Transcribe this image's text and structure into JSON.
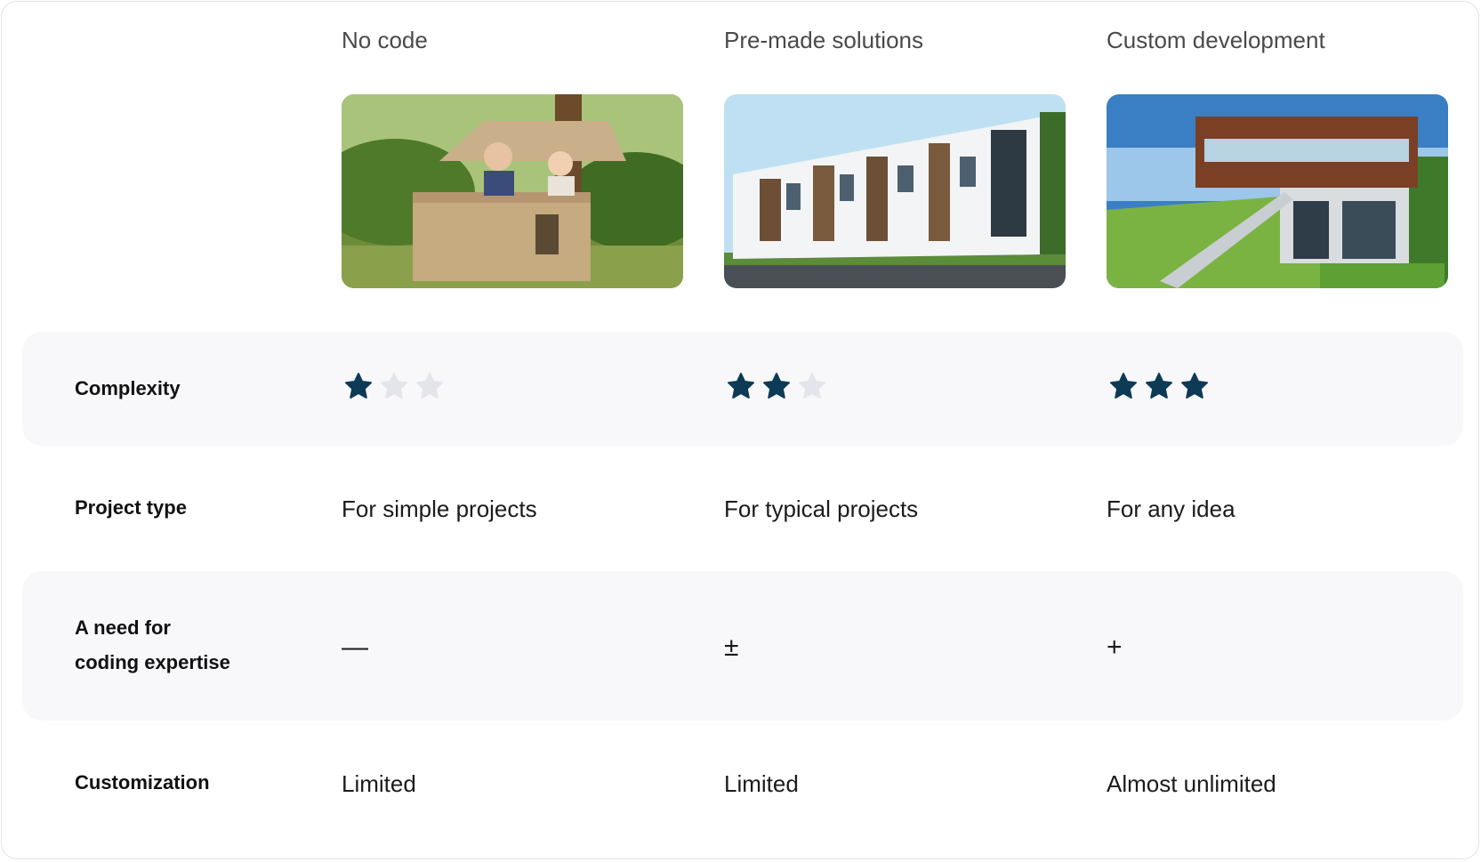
{
  "columns": [
    {
      "title": "No code",
      "image": "cardboard-playhouse-photo",
      "stars": 1,
      "project_type": "For simple projects",
      "coding_symbol": "—",
      "customization": "Limited"
    },
    {
      "title": "Pre-made solutions",
      "image": "townhouses-photo",
      "stars": 2,
      "project_type": "For typical projects",
      "coding_symbol": "±",
      "customization": "Limited"
    },
    {
      "title": "Custom development",
      "image": "modern-building-photo",
      "stars": 3,
      "project_type": "For any idea",
      "coding_symbol": "+",
      "customization": "Almost unlimited"
    }
  ],
  "rows": {
    "complexity": "Complexity",
    "project_type": "Project type",
    "coding_line1": "A need for",
    "coding_line2": "coding expertise",
    "customization": "Customization"
  },
  "colors": {
    "star_filled": "#0d3a55",
    "star_empty": "#e4e5ea",
    "band": "#f8f8fb"
  },
  "stars_max": 3
}
